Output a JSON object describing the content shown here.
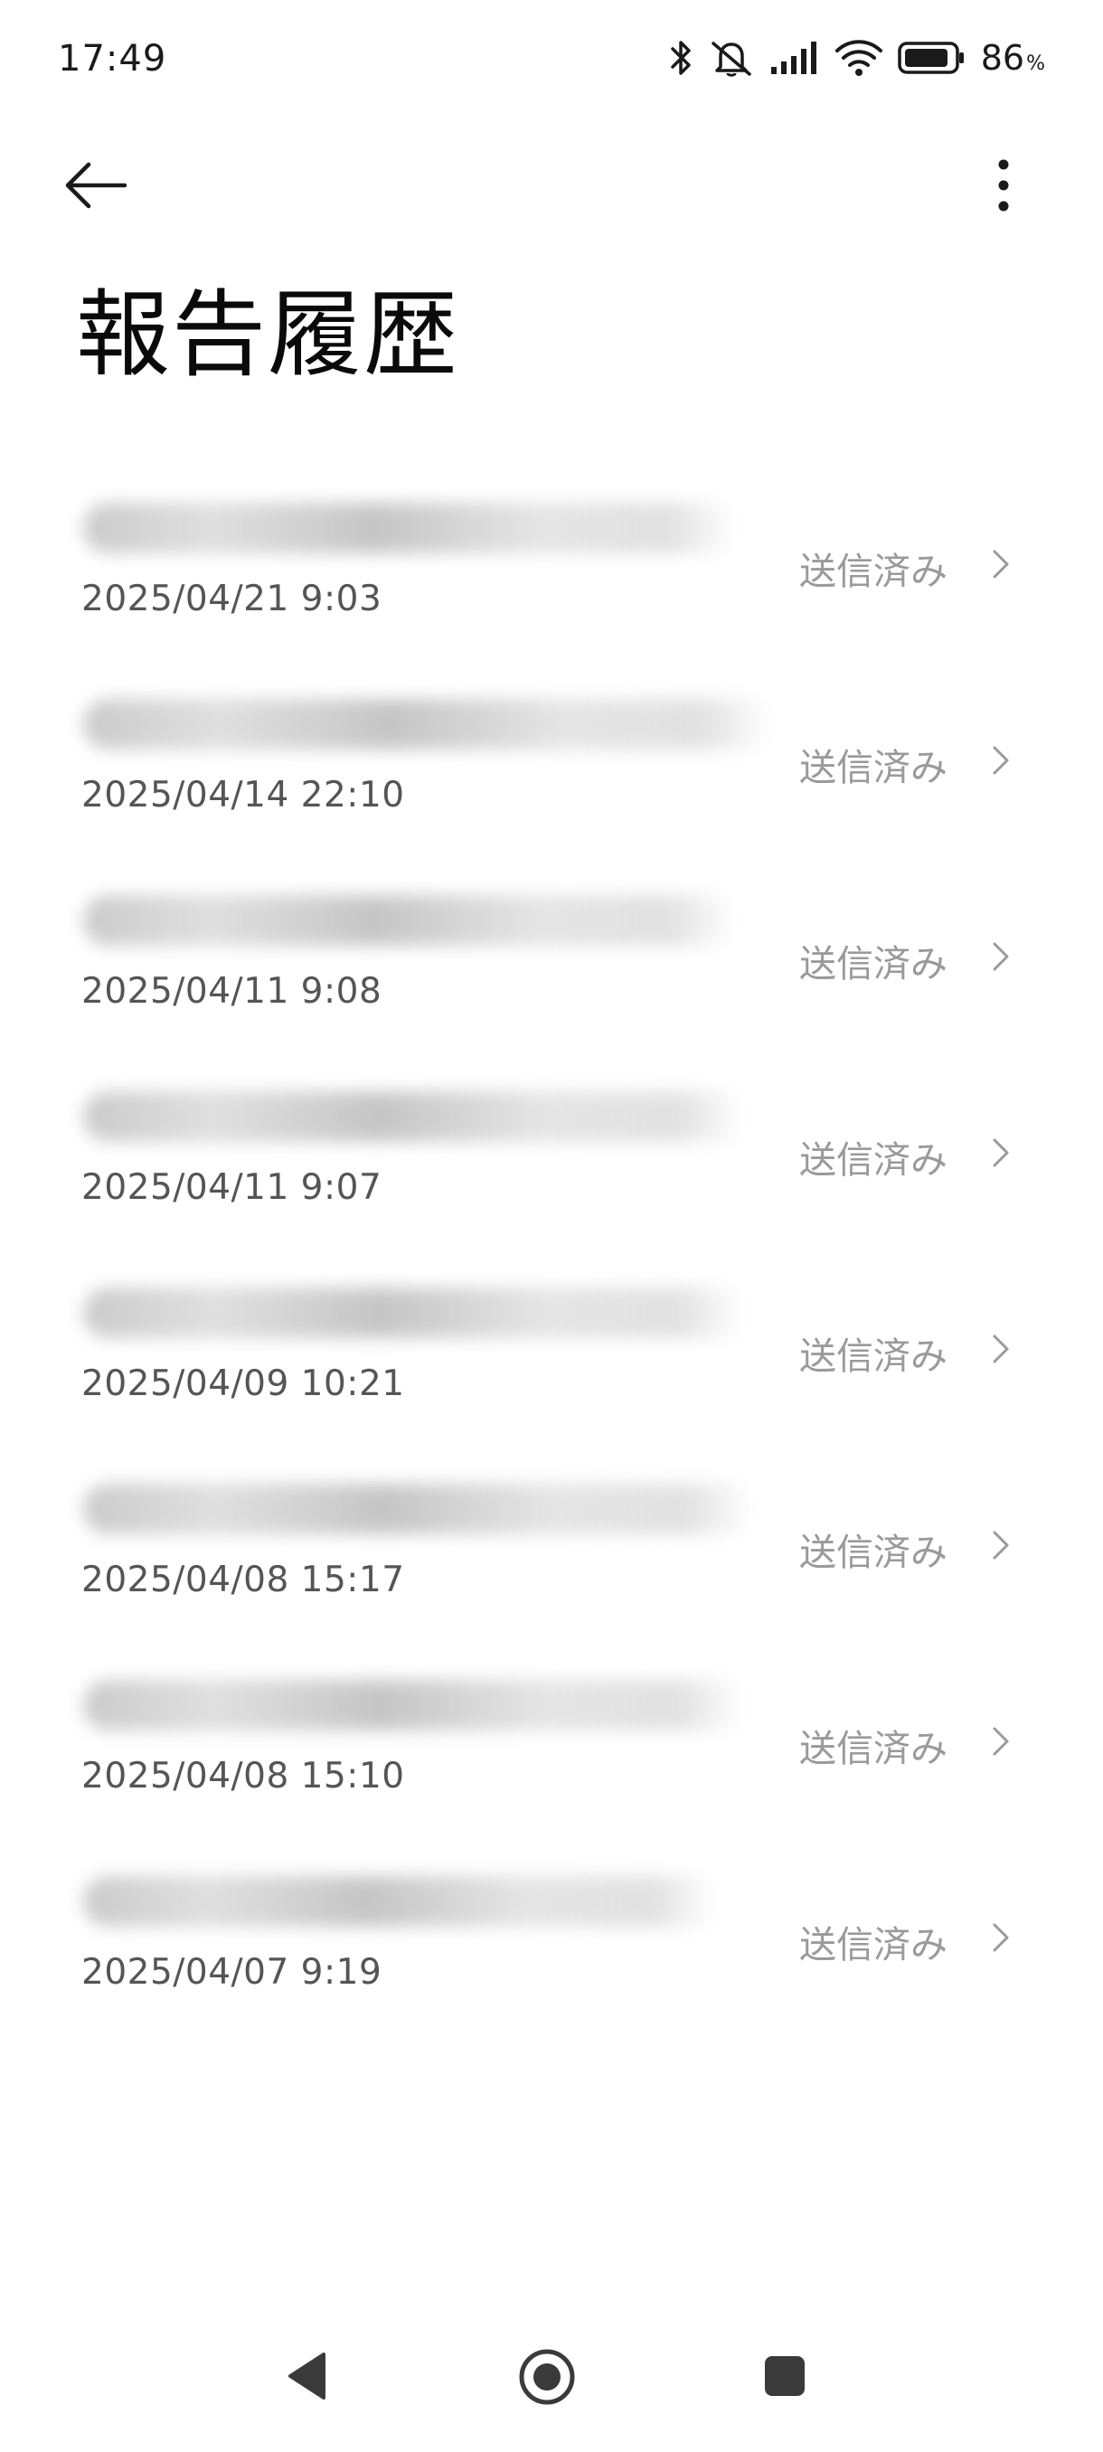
{
  "status_bar": {
    "time": "17:49",
    "battery_percent": "86",
    "battery_unit": "%",
    "icons": [
      "bluetooth-icon",
      "muted-bell-icon",
      "signal-icon",
      "wifi-icon",
      "battery-icon"
    ]
  },
  "header": {
    "title": "報告履歴",
    "back_icon": "arrow-left-icon",
    "menu_icon": "more-vertical-icon"
  },
  "reports": [
    {
      "date": "2025/04/21 9:03",
      "status": "送信済み"
    },
    {
      "date": "2025/04/14 22:10",
      "status": "送信済み"
    },
    {
      "date": "2025/04/11 9:08",
      "status": "送信済み"
    },
    {
      "date": "2025/04/11 9:07",
      "status": "送信済み"
    },
    {
      "date": "2025/04/09 10:21",
      "status": "送信済み"
    },
    {
      "date": "2025/04/08 15:17",
      "status": "送信済み"
    },
    {
      "date": "2025/04/08 15:10",
      "status": "送信済み"
    },
    {
      "date": "2025/04/07 9:19",
      "status": "送信済み"
    }
  ],
  "nav_bar": {
    "icons": [
      "nav-back-icon",
      "nav-home-icon",
      "nav-recents-icon"
    ]
  },
  "colors": {
    "status_text": "#9a9a9a",
    "date_text": "#555555",
    "title_text": "#0a0a0a"
  }
}
